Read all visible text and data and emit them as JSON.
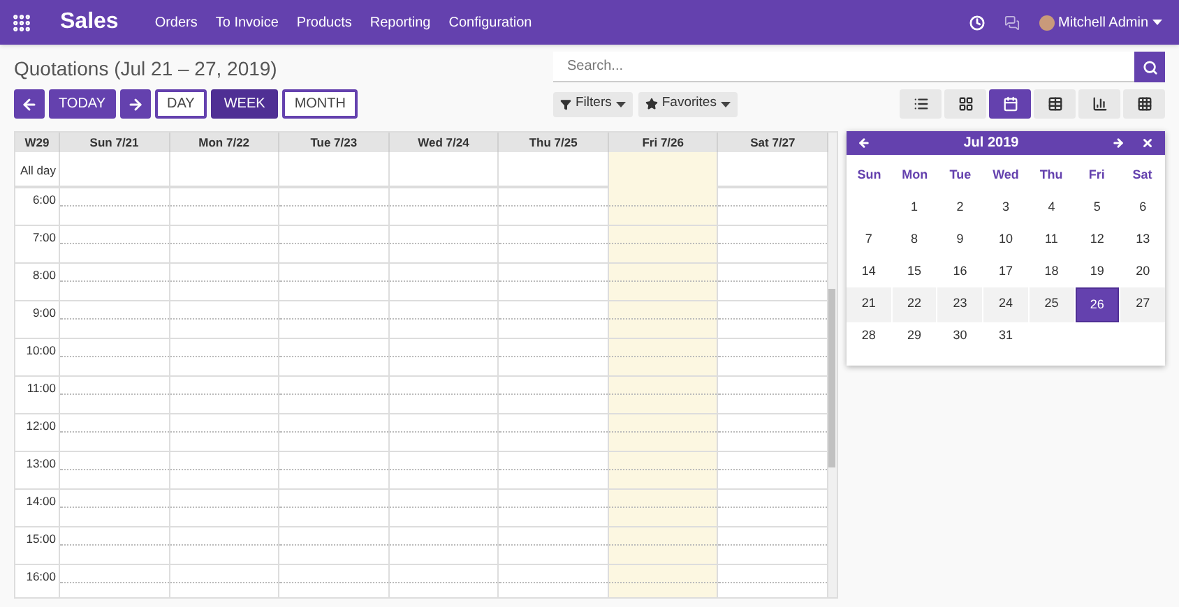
{
  "navbar": {
    "app_title": "Sales",
    "menu": [
      "Orders",
      "To Invoice",
      "Products",
      "Reporting",
      "Configuration"
    ],
    "user": "Mitchell Admin"
  },
  "title": "Quotations (Jul 21 – 27, 2019)",
  "nav_buttons": [
    {
      "kind": "prev"
    },
    {
      "kind": "today",
      "label": "TODAY"
    },
    {
      "kind": "next"
    }
  ],
  "scale_buttons": [
    {
      "label": "DAY",
      "selected": false
    },
    {
      "label": "WEEK",
      "selected": true
    },
    {
      "label": "MONTH",
      "selected": false
    }
  ],
  "search": {
    "placeholder": "Search..."
  },
  "filter_buttons": [
    {
      "kind": "filter",
      "label": "Filters"
    },
    {
      "kind": "favorite",
      "label": "Favorites"
    }
  ],
  "view_switcher": [
    {
      "kind": "list",
      "selected": false
    },
    {
      "kind": "kanban",
      "selected": false
    },
    {
      "kind": "calendar",
      "selected": true
    },
    {
      "kind": "pivot",
      "selected": false
    },
    {
      "kind": "graph",
      "selected": false
    },
    {
      "kind": "activity",
      "selected": false
    }
  ],
  "calendar": {
    "week_label": "W29",
    "all_day_label": "All day",
    "columns": [
      {
        "label": "Sun 7/21",
        "today": false
      },
      {
        "label": "Mon 7/22",
        "today": false
      },
      {
        "label": "Tue 7/23",
        "today": false
      },
      {
        "label": "Wed 7/24",
        "today": false
      },
      {
        "label": "Thu 7/25",
        "today": false
      },
      {
        "label": "Fri 7/26",
        "today": true
      },
      {
        "label": "Sat 7/27",
        "today": false
      }
    ],
    "hours": [
      "6:00",
      "7:00",
      "8:00",
      "9:00",
      "10:00",
      "11:00",
      "12:00",
      "13:00",
      "14:00",
      "15:00",
      "16:00"
    ]
  },
  "mini_calendar": {
    "title": "Jul 2019",
    "weekdays": [
      "Sun",
      "Mon",
      "Tue",
      "Wed",
      "Thu",
      "Fri",
      "Sat"
    ],
    "weeks": [
      {
        "kind": "leading",
        "current": false,
        "days": [
          {
            "label": "1",
            "selected": false
          },
          {
            "label": "2",
            "selected": false
          },
          {
            "label": "3",
            "selected": false
          },
          {
            "label": "4",
            "selected": false
          },
          {
            "label": "5",
            "selected": false
          },
          {
            "label": "6",
            "selected": false
          }
        ]
      },
      {
        "current": false,
        "days": [
          {
            "label": "7",
            "selected": false
          },
          {
            "label": "8",
            "selected": false
          },
          {
            "label": "9",
            "selected": false
          },
          {
            "label": "10",
            "selected": false
          },
          {
            "label": "11",
            "selected": false
          },
          {
            "label": "12",
            "selected": false
          },
          {
            "label": "13",
            "selected": false
          }
        ]
      },
      {
        "current": false,
        "days": [
          {
            "label": "14",
            "selected": false
          },
          {
            "label": "15",
            "selected": false
          },
          {
            "label": "16",
            "selected": false
          },
          {
            "label": "17",
            "selected": false
          },
          {
            "label": "18",
            "selected": false
          },
          {
            "label": "19",
            "selected": false
          },
          {
            "label": "20",
            "selected": false
          }
        ]
      },
      {
        "current": true,
        "days": [
          {
            "label": "21",
            "selected": false
          },
          {
            "label": "22",
            "selected": false
          },
          {
            "label": "23",
            "selected": false
          },
          {
            "label": "24",
            "selected": false
          },
          {
            "label": "25",
            "selected": false
          },
          {
            "label": "26",
            "selected": true
          },
          {
            "label": "27",
            "selected": false
          }
        ]
      },
      {
        "current": false,
        "days": [
          {
            "label": "28",
            "selected": false
          },
          {
            "label": "29",
            "selected": false
          },
          {
            "label": "30",
            "selected": false
          },
          {
            "label": "31",
            "selected": false
          }
        ]
      }
    ]
  }
}
